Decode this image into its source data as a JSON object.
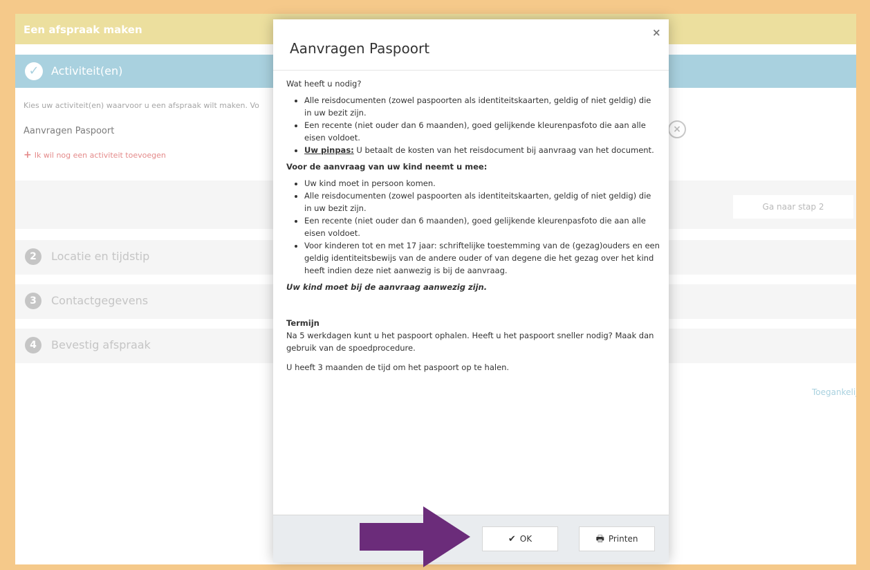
{
  "app": {
    "title": "Een afspraak maken"
  },
  "steps": [
    {
      "number": "",
      "label": "Activiteit(en)"
    },
    {
      "number": "2",
      "label": "Locatie en tijdstip"
    },
    {
      "number": "3",
      "label": "Contactgegevens"
    },
    {
      "number": "4",
      "label": "Bevestig afspraak"
    }
  ],
  "step1": {
    "intro": "Kies uw activiteit(en) waarvoor u een afspraak wilt maken. Vo",
    "activity": "Aanvragen Paspoort",
    "add_link": "Ik wil nog een activiteit toevoegen",
    "next_button": "Ga naar stap 2"
  },
  "footer": {
    "accessibility_link": "Toegankelijkhe"
  },
  "modal": {
    "title": "Aanvragen Paspoort",
    "close": "×",
    "intro": "Wat heeft u nodig?",
    "list1": [
      "Alle reisdocumenten (zowel paspoorten als identiteitskaarten, geldig of niet geldig) die in uw bezit zijn.",
      "Een recente (niet ouder dan 6 maanden), goed gelijkende kleurenpasfoto die aan alle eisen voldoet."
    ],
    "pinpas_label": "Uw pinpas:",
    "pinpas_text": " U betaalt de kosten van het reisdocument bij aanvraag van het document.",
    "kind_heading": "Voor de aanvraag van uw kind neemt u mee:",
    "list2": [
      "Uw kind moet in persoon komen.",
      "Alle reisdocumenten (zowel paspoorten als identiteitskaarten, geldig of niet geldig) die in uw bezit zijn.",
      "Een recente (niet ouder dan 6 maanden), goed gelijkende kleurenpasfoto die aan alle eisen voldoet.",
      "Voor kinderen tot en met 17 jaar: schriftelijke toestemming van de (gezag)ouders en een geldig identiteitsbewijs van de andere ouder of van degene die het gezag over het kind heeft indien deze niet aanwezig is bij de aanvraag."
    ],
    "kind_note": "Uw kind moet bij de aanvraag aanwezig zijn.",
    "termijn_heading": "Termijn",
    "termijn_text": "Na 5 werkdagen kunt u het paspoort ophalen. Heeft u het paspoort sneller nodig? Maak dan gebruik van de spoedprocedure.",
    "pickup_text": "U heeft 3 maanden de tijd om het paspoort op te halen.",
    "ok_button": "OK",
    "print_button": "Printen"
  },
  "colors": {
    "page_border": "#f5c98a",
    "topbar": "#ecdf9e",
    "active_step": "#a9d1df",
    "arrow": "#6b2c7a",
    "link_red": "#e48a8a"
  }
}
